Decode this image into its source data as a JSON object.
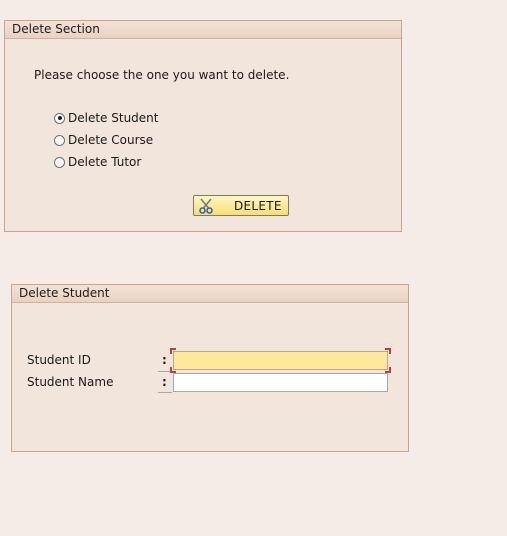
{
  "delete_section": {
    "title": "Delete Section",
    "prompt": "Please choose the one you want to delete.",
    "options": [
      {
        "label": "Delete Student",
        "selected": true
      },
      {
        "label": "Delete Course",
        "selected": false
      },
      {
        "label": "Delete Tutor",
        "selected": false
      }
    ],
    "delete_button_label": "DELETE",
    "delete_button_icon": "scissors-icon"
  },
  "delete_student": {
    "title": "Delete Student",
    "fields": [
      {
        "label": "Student ID",
        "colon": ":",
        "value": ""
      },
      {
        "label": "Student Name",
        "colon": ":",
        "value": ""
      }
    ]
  },
  "colors": {
    "panel_background": "#f2e5dc",
    "page_background": "#f5ece7",
    "focused_field": "#fde89c",
    "button_gradient_bottom": "#f7de73"
  }
}
